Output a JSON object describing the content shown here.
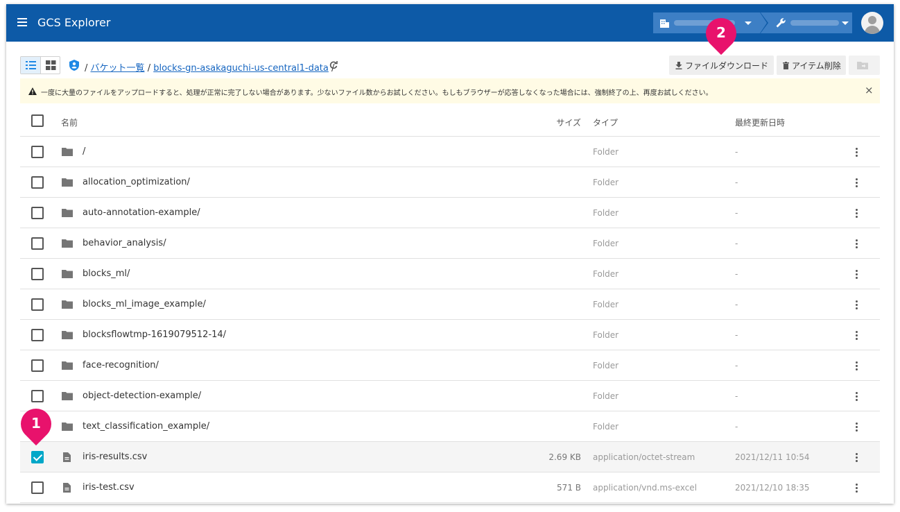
{
  "app": {
    "title": "GCS Explorer"
  },
  "header": {
    "organization_selector": "",
    "project_selector": ""
  },
  "breadcrumb": {
    "sep1": "/",
    "root_link": "バケット一覧",
    "sep2": "/",
    "bucket_link": "blocks-gn-asakaguchi-us-central1-data",
    "sep3": "/"
  },
  "toolbar": {
    "download_label": "ファイルダウンロード",
    "delete_label": "アイテム削除"
  },
  "banner": {
    "message": "一度に大量のファイルをアップロードすると、処理が正常に完了しない場合があります。少ないファイル数からお試しください。もしもブラウザーが応答しなくなった場合には、強制終了の上、再度お試しください。",
    "close": "×"
  },
  "table": {
    "columns": {
      "name": "名前",
      "size": "サイズ",
      "type": "タイプ",
      "modified": "最終更新日時"
    },
    "rows": [
      {
        "kind": "folder",
        "name": "/",
        "size": "",
        "type": "Folder",
        "modified": "-",
        "checked": false
      },
      {
        "kind": "folder",
        "name": "allocation_optimization/",
        "size": "",
        "type": "Folder",
        "modified": "-",
        "checked": false
      },
      {
        "kind": "folder",
        "name": "auto-annotation-example/",
        "size": "",
        "type": "Folder",
        "modified": "-",
        "checked": false
      },
      {
        "kind": "folder",
        "name": "behavior_analysis/",
        "size": "",
        "type": "Folder",
        "modified": "-",
        "checked": false
      },
      {
        "kind": "folder",
        "name": "blocks_ml/",
        "size": "",
        "type": "Folder",
        "modified": "-",
        "checked": false
      },
      {
        "kind": "folder",
        "name": "blocks_ml_image_example/",
        "size": "",
        "type": "Folder",
        "modified": "-",
        "checked": false
      },
      {
        "kind": "folder",
        "name": "blocksflowtmp-1619079512-14/",
        "size": "",
        "type": "Folder",
        "modified": "-",
        "checked": false
      },
      {
        "kind": "folder",
        "name": "face-recognition/",
        "size": "",
        "type": "Folder",
        "modified": "-",
        "checked": false
      },
      {
        "kind": "folder",
        "name": "object-detection-example/",
        "size": "",
        "type": "Folder",
        "modified": "-",
        "checked": false
      },
      {
        "kind": "folder",
        "name": "text_classification_example/",
        "size": "",
        "type": "Folder",
        "modified": "-",
        "checked": false
      },
      {
        "kind": "file",
        "name": "iris-results.csv",
        "size": "2.69 KB",
        "type": "application/octet-stream",
        "modified": "2021/12/11 10:54",
        "checked": true
      },
      {
        "kind": "file",
        "name": "iris-test.csv",
        "size": "571 B",
        "type": "application/vnd.ms-excel",
        "modified": "2021/12/10 18:35",
        "checked": false
      }
    ]
  },
  "callouts": {
    "step1": "1",
    "step2": "2"
  },
  "colors": {
    "header": "#0d5aa7",
    "accent": "#e8126c",
    "checkbox": "#00a7c8",
    "banner": "#fffbe5"
  }
}
